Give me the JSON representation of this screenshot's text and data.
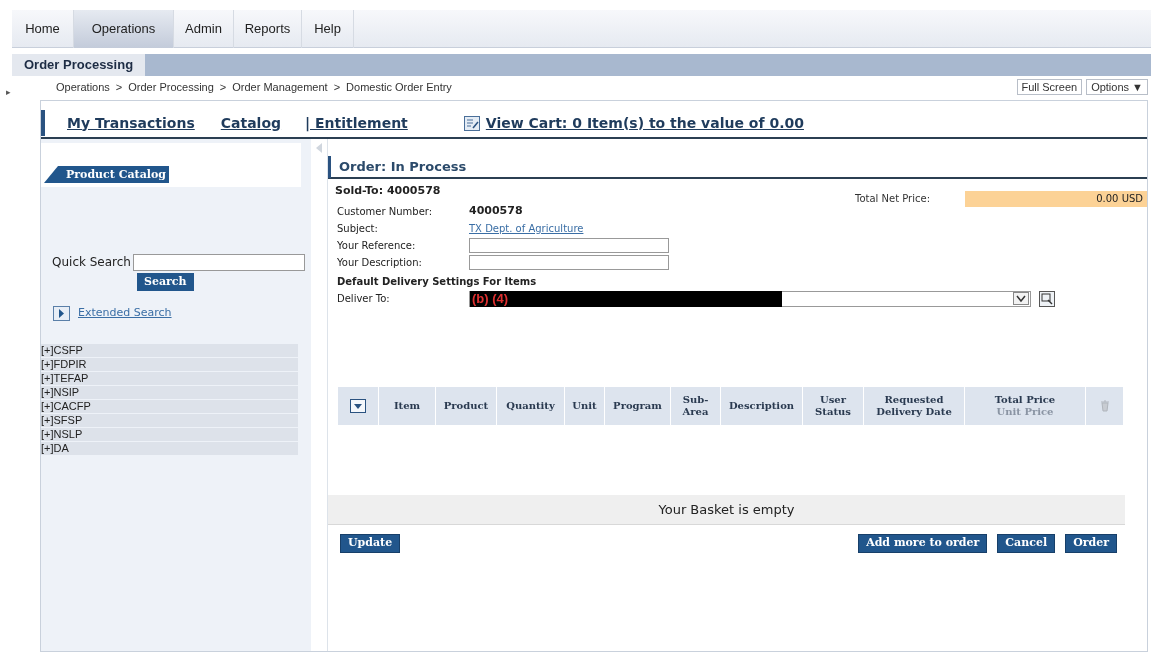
{
  "tabs": [
    {
      "label": "Home",
      "selected": false
    },
    {
      "label": "Operations",
      "selected": true
    },
    {
      "label": "Admin",
      "selected": false
    },
    {
      "label": "Reports",
      "selected": false
    },
    {
      "label": "Help",
      "selected": false
    }
  ],
  "sub_tab": "Order Processing",
  "breadcrumb": [
    "Operations",
    "Order Processing",
    "Order Management",
    "Domestic Order Entry"
  ],
  "breadcrumb_separator": ">",
  "top_buttons": [
    "Full Screen",
    "Options ▼"
  ],
  "side_toggle": "▸",
  "nav_links": [
    {
      "label": "My Transactions",
      "kind": "link"
    },
    {
      "label": "Catalog",
      "kind": "link"
    },
    {
      "label": "| Entitlement",
      "kind": "link"
    },
    {
      "label": "View Cart: 0 Item(s) to the value of 0.00",
      "kind": "cart"
    }
  ],
  "catalog": {
    "title": "Product Catalog",
    "quick_search_label": "Quick Search",
    "search_button": "Search",
    "extended_search": "Extended Search",
    "tree": [
      {
        "label": "[+]CSFP",
        "expanded": false
      },
      {
        "label": "[+]FDPIR",
        "expanded": false
      },
      {
        "label": "[+]TEFAP",
        "expanded": false
      },
      {
        "label": "[+]NSIP",
        "expanded": false
      },
      {
        "label": "[+]CACFP",
        "expanded": false
      },
      {
        "label": "[+]SFSP",
        "expanded": false
      },
      {
        "label": "[+]NSLP",
        "expanded": false
      },
      {
        "label": "[+]DA",
        "expanded": false
      }
    ]
  },
  "order": {
    "title": "Order: In Process",
    "sold_to": "Sold-To: 4000578",
    "total_net_price_label": "Total Net Price:",
    "total_net_price": "0.00 USD",
    "fields": [
      {
        "label": "Customer Number:",
        "value": "4000578",
        "kind": "bold"
      },
      {
        "label": "Subject:",
        "value": "TX Dept. of Agriculture",
        "kind": "link"
      },
      {
        "label": "Your Reference:",
        "kind": "input"
      },
      {
        "label": "Your Description:",
        "kind": "input"
      }
    ],
    "delivery_heading": "Default Delivery Settings For Items",
    "deliver_to_label": "Deliver To:",
    "redaction_label": "(b) (4)"
  },
  "table": {
    "columns": [
      {
        "label": "Item"
      },
      {
        "label": "Product"
      },
      {
        "label": "Quantity"
      },
      {
        "label": "Unit"
      },
      {
        "label": "Program"
      },
      {
        "label": "Sub-Area"
      },
      {
        "label": "Description"
      },
      {
        "label": "User Status"
      },
      {
        "label": "Requested Delivery Date"
      },
      {
        "label": "Total Price",
        "sublabel": "Unit Price"
      }
    ],
    "empty_message": "Your Basket is empty"
  },
  "buttons_left": [
    "Update"
  ],
  "buttons_right": [
    "Add more to order",
    "Cancel",
    "Order"
  ]
}
